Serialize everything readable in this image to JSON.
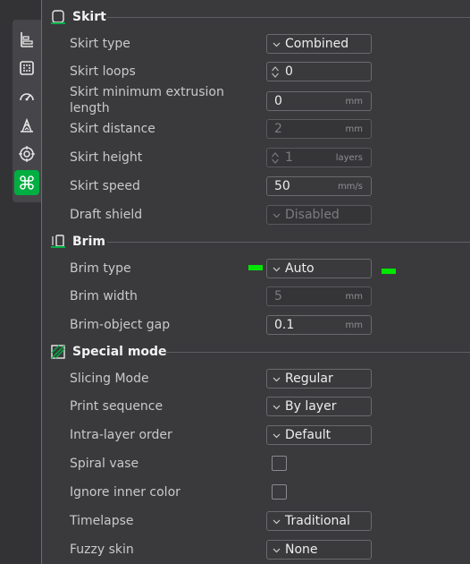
{
  "colors": {
    "accent": "#00ae42",
    "marker": "#00e600"
  },
  "sidebar": {
    "icons": [
      "quality-icon",
      "strength-icon",
      "speed-icon",
      "support-icon",
      "multimaterial-icon",
      "others-icon"
    ],
    "active": "others-icon"
  },
  "skirt": {
    "title": "Skirt",
    "type": {
      "label": "Skirt type",
      "value": "Combined"
    },
    "loops": {
      "label": "Skirt loops",
      "value": "0"
    },
    "min_extrusion": {
      "label": "Skirt minimum extrusion length",
      "value": "0",
      "unit": "mm"
    },
    "distance": {
      "label": "Skirt distance",
      "value": "2",
      "unit": "mm"
    },
    "height": {
      "label": "Skirt height",
      "value": "1",
      "unit": "layers"
    },
    "speed": {
      "label": "Skirt speed",
      "value": "50",
      "unit": "mm/s"
    },
    "draft_shield": {
      "label": "Draft shield",
      "value": "Disabled"
    }
  },
  "brim": {
    "title": "Brim",
    "type": {
      "label": "Brim type",
      "value": "Auto"
    },
    "width": {
      "label": "Brim width",
      "value": "5",
      "unit": "mm"
    },
    "gap": {
      "label": "Brim-object gap",
      "value": "0.1",
      "unit": "mm"
    }
  },
  "special": {
    "title": "Special mode",
    "slicing_mode": {
      "label": "Slicing Mode",
      "value": "Regular"
    },
    "print_sequence": {
      "label": "Print sequence",
      "value": "By layer"
    },
    "intra_layer_order": {
      "label": "Intra-layer order",
      "value": "Default"
    },
    "spiral_vase": {
      "label": "Spiral vase",
      "checked": false
    },
    "ignore_inner_color": {
      "label": "Ignore inner color",
      "checked": false
    },
    "timelapse": {
      "label": "Timelapse",
      "value": "Traditional"
    },
    "fuzzy_skin": {
      "label": "Fuzzy skin",
      "value": "None"
    }
  }
}
